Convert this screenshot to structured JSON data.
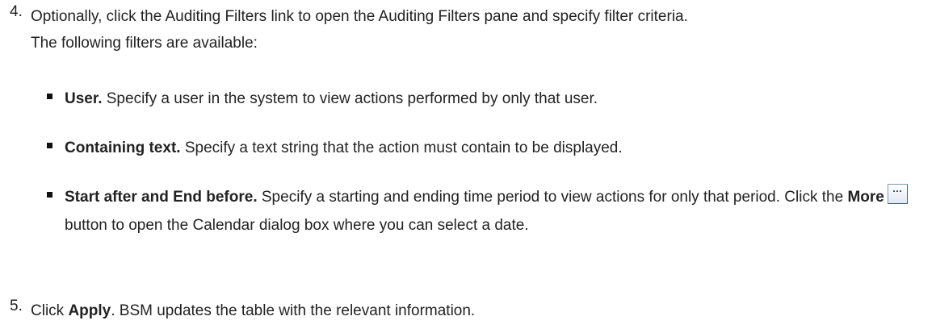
{
  "step4": {
    "number": "4.",
    "text_line1": "Optionally, click the Auditing Filters link to open the Auditing Filters pane and specify filter criteria.",
    "text_line2": "The following filters are available:"
  },
  "bullets": [
    {
      "bold": "User.",
      "text": " Specify a user in the system to view actions performed by only that user."
    },
    {
      "bold": "Containing text.",
      "text": " Specify a text string that the action must contain to be displayed."
    },
    {
      "bold": "Start after and End before.",
      "text": " Specify a starting and ending time period to view actions for only that period. Click the ",
      "bold2": "More",
      "button_glyph": "···",
      "text2": " button to open the Calendar dialog box where you can select a date."
    }
  ],
  "step5": {
    "number": "5.",
    "text_before": "Click ",
    "bold": "Apply",
    "text_after": ". BSM updates the table with the relevant information."
  }
}
